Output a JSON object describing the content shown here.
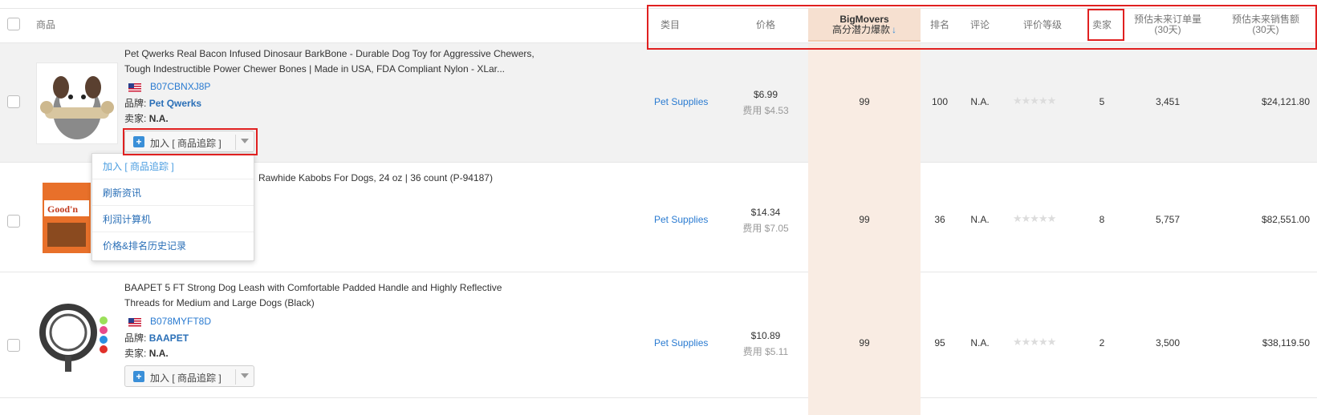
{
  "header": {
    "product": "商品",
    "category": "类目",
    "price": "价格",
    "bigmovers_title": "BigMovers",
    "bigmovers_sub": "高分潜力爆款",
    "sort_arrow": "↓",
    "rank": "排名",
    "reviews": "评论",
    "rating": "评价等级",
    "sellers": "卖家",
    "est_orders_line1": "预估未来订单量",
    "est_orders_line2": "(30天)",
    "est_sales_line1": "预估未来销售额",
    "est_sales_line2": "(30天)"
  },
  "labels": {
    "brand": "品牌:",
    "seller": "卖家:",
    "add_track": "加入 [ 商品追踪 ]"
  },
  "rows": [
    {
      "title_line1": "Pet Qwerks Real Bacon Infused Dinosaur BarkBone - Durable Dog Toy for Aggressive Chewers,",
      "title_line2": "Tough Indestructible Power Chewer Bones | Made in USA, FDA Compliant Nylon - XLar...",
      "asin": "B07CBNXJ8P",
      "brand": "Pet Qwerks",
      "seller": "N.A.",
      "category": "Pet Supplies",
      "price": "$6.99",
      "fee": "费用 $4.53",
      "bigmovers": "99",
      "rank": "100",
      "reviews": "N.A.",
      "rating_stars": 0,
      "sellers": "5",
      "est_orders": "3,451",
      "est_sales": "$24,121.80"
    },
    {
      "title_line1": "Rawhide Kabobs For Dogs, 24 oz | 36 count (P-94187)",
      "category": "Pet Supplies",
      "price": "$14.34",
      "fee": "费用 $7.05",
      "bigmovers": "99",
      "rank": "36",
      "reviews": "N.A.",
      "rating_stars": 0,
      "sellers": "8",
      "est_orders": "5,757",
      "est_sales": "$82,551.00"
    },
    {
      "title_line1": "BAAPET 5 FT Strong Dog Leash with Comfortable Padded Handle and Highly Reflective",
      "title_line2": "Threads for Medium and Large Dogs (Black)",
      "asin": "B078MYFT8D",
      "brand": "BAAPET",
      "seller": "N.A.",
      "category": "Pet Supplies",
      "price": "$10.89",
      "fee": "费用 $5.11",
      "bigmovers": "99",
      "rank": "95",
      "reviews": "N.A.",
      "rating_stars": 0,
      "sellers": "2",
      "est_orders": "3,500",
      "est_sales": "$38,119.50"
    }
  ],
  "dropdown_menu": {
    "items": [
      "加入 [ 商品追踪 ]",
      "刷新资讯",
      "利润计算机",
      "价格&排名历史记录"
    ]
  },
  "colors": {
    "accent_blue": "#2a7bd1",
    "sorted_column": "#f9ece3",
    "highlight_box": "#e02020"
  }
}
